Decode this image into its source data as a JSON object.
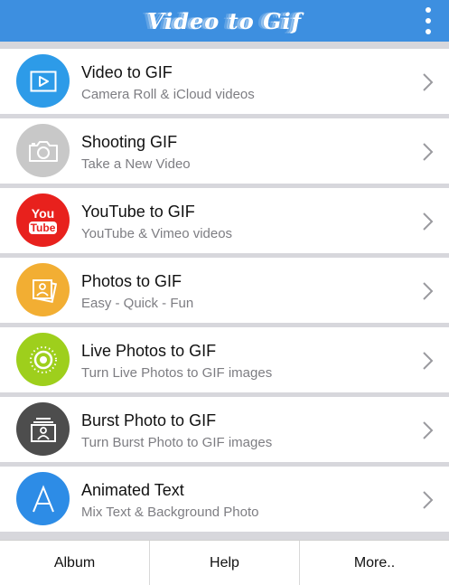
{
  "header": {
    "title": "Video to Gif",
    "menu_icon": "more-vertical-icon"
  },
  "items": [
    {
      "title": "Video to GIF",
      "subtitle": "Camera Roll & iCloud videos",
      "icon": "play-icon",
      "color": "#2d9be8"
    },
    {
      "title": "Shooting GIF",
      "subtitle": "Take a New Video",
      "icon": "camera-icon",
      "color": "#c8c8c8"
    },
    {
      "title": "YouTube to GIF",
      "subtitle": "YouTube & Vimeo videos",
      "icon": "youtube-icon",
      "color": "#e8211d",
      "icon_text_top": "You",
      "icon_text_bottom": "Tube"
    },
    {
      "title": "Photos to GIF",
      "subtitle": "Easy - Quick - Fun",
      "icon": "photos-icon",
      "color": "#f2ae33"
    },
    {
      "title": "Live Photos to GIF",
      "subtitle": "Turn Live Photos to GIF images",
      "icon": "live-photo-icon",
      "color": "#9ecf1c"
    },
    {
      "title": "Burst Photo to GIF",
      "subtitle": "Turn Burst Photo to GIF images",
      "icon": "burst-photo-icon",
      "color": "#4d4d4d"
    },
    {
      "title": "Animated Text",
      "subtitle": "Mix Text & Background Photo",
      "icon": "text-a-icon",
      "color": "#2d8ce6",
      "icon_text": "A"
    }
  ],
  "tabbar": {
    "album": "Album",
    "help": "Help",
    "more": "More.."
  }
}
